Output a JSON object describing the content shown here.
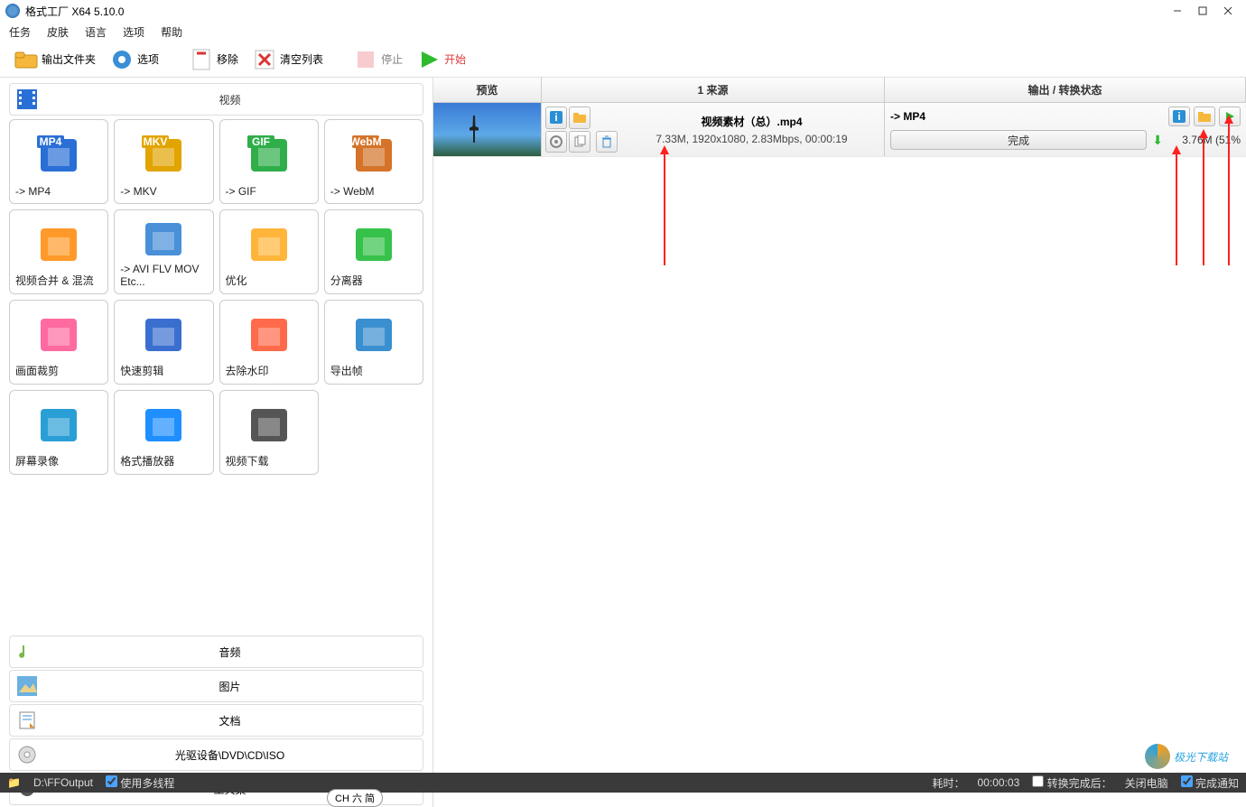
{
  "title": "格式工厂 X64 5.10.0",
  "menu": [
    "任务",
    "皮肤",
    "语言",
    "选项",
    "帮助"
  ],
  "toolbar": {
    "output_folder": "输出文件夹",
    "options": "选项",
    "remove": "移除",
    "clear_list": "清空列表",
    "stop": "停止",
    "start": "开始"
  },
  "categories": {
    "video": "视频",
    "audio": "音频",
    "image": "图片",
    "document": "文档",
    "disc": "光驱设备\\DVD\\CD\\ISO",
    "tools": "工具集"
  },
  "tiles": [
    {
      "label": "-> MP4",
      "badge": "MP4",
      "bg": "#2a6fd6"
    },
    {
      "label": "-> MKV",
      "badge": "MKV",
      "bg": "#e2a400"
    },
    {
      "label": "-> GIF",
      "badge": "GIF",
      "bg": "#2fae4a"
    },
    {
      "label": "-> WebM",
      "badge": "WebM",
      "bg": "#d57328"
    },
    {
      "label": "视频合并 & 混流",
      "badge": "",
      "bg": "#ff9a2a"
    },
    {
      "label": "-> AVI FLV MOV Etc...",
      "badge": "",
      "bg": "#4a90d9"
    },
    {
      "label": "优化",
      "badge": "",
      "bg": "#ffb53a"
    },
    {
      "label": "",
      "badge": "",
      "bg": "transparent",
      "empty": true
    },
    {
      "label": "分离器",
      "badge": "",
      "bg": "#36c24a"
    },
    {
      "label": "画面裁剪",
      "badge": "",
      "bg": "#ff6aa0"
    },
    {
      "label": "快速剪辑",
      "badge": "",
      "bg": "#3a6fd0"
    },
    {
      "label": "去除水印",
      "badge": "",
      "bg": "#ff6a4a"
    },
    {
      "label": "导出帧",
      "badge": "",
      "bg": "#3a8fd0"
    },
    {
      "label": "屏幕录像",
      "badge": "",
      "bg": "#2a9fd6"
    },
    {
      "label": "格式播放器",
      "badge": "",
      "bg": "#1f8fff"
    },
    {
      "label": "视频下载",
      "badge": "",
      "bg": "#555"
    }
  ],
  "columns": {
    "preview": "预览",
    "source": "1 来源",
    "output": "输出 / 转换状态"
  },
  "task": {
    "filename": "视频素材（总）.mp4",
    "meta": "7.33M, 1920x1080, 2.83Mbps, 00:00:19",
    "target": "-> MP4",
    "progress_label": "完成",
    "out_size": "3.76M (51%",
    "src_buttons": [
      "info",
      "folder",
      "settings",
      "copy",
      "delete"
    ],
    "out_buttons": [
      "info",
      "folder",
      "play"
    ]
  },
  "status": {
    "folder_icon": "folder",
    "output_path": "D:\\FFOutput",
    "multithread": "使用多线程",
    "elapsed_label": "耗时：",
    "elapsed": "00:00:03",
    "after_label": "转换完成后：",
    "after_value": "关闭电脑",
    "notify": "完成通知"
  },
  "watermark": "极光下载站",
  "ime": "CH 六 简"
}
